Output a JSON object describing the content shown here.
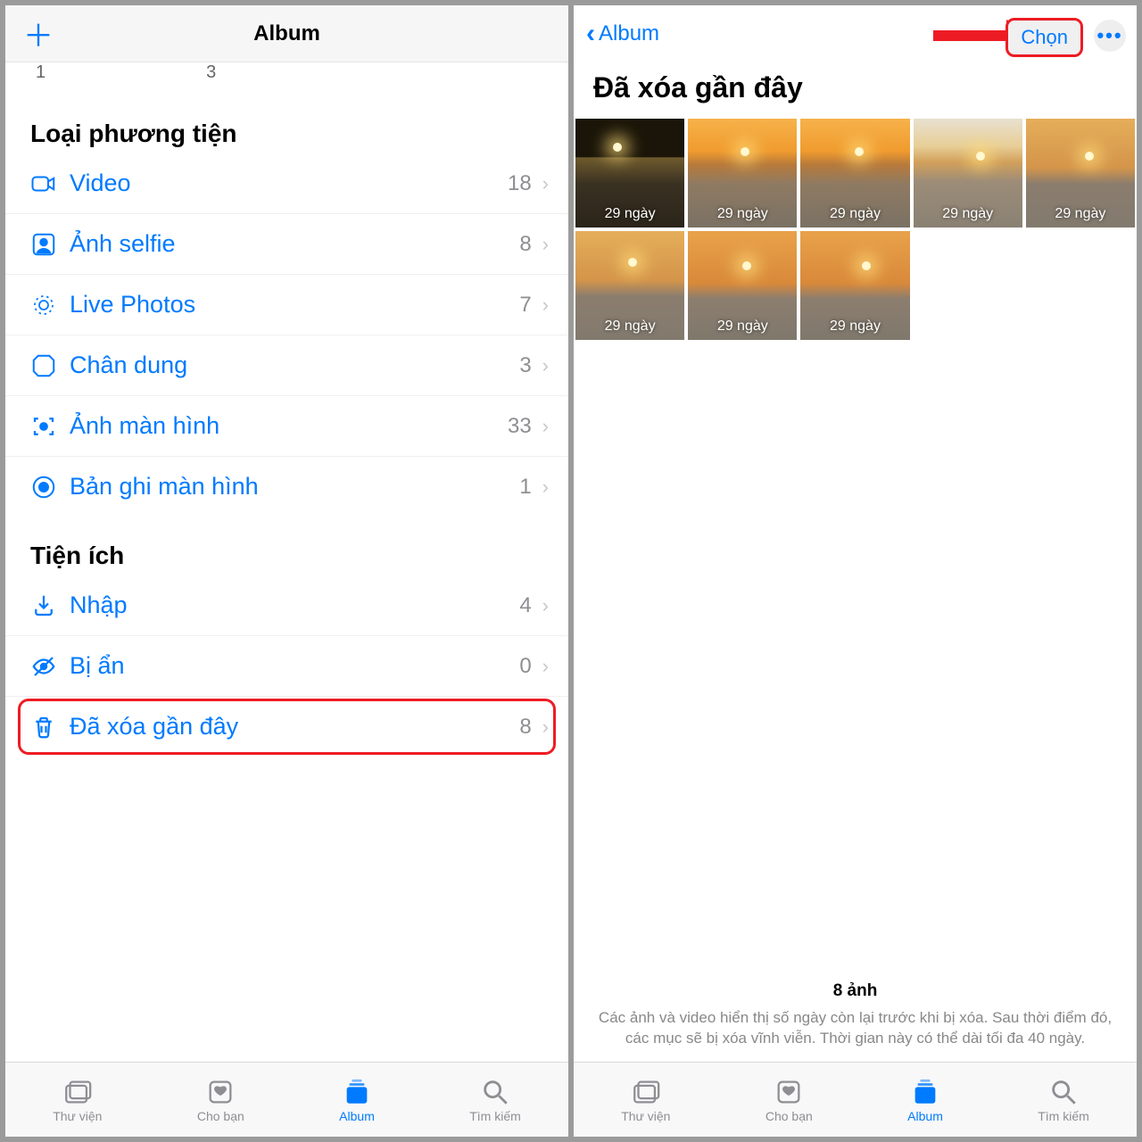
{
  "left": {
    "title": "Album",
    "nums": {
      "a": "1",
      "b": "3"
    },
    "section_media": "Loại phương tiện",
    "media_rows": [
      {
        "label": "Video",
        "count": "18"
      },
      {
        "label": "Ảnh selfie",
        "count": "8"
      },
      {
        "label": "Live Photos",
        "count": "7"
      },
      {
        "label": "Chân dung",
        "count": "3"
      },
      {
        "label": "Ảnh màn hình",
        "count": "33"
      },
      {
        "label": "Bản ghi màn hình",
        "count": "1"
      }
    ],
    "section_util": "Tiện ích",
    "util_rows": [
      {
        "label": "Nhập",
        "count": "4"
      },
      {
        "label": "Bị ẩn",
        "count": "0"
      },
      {
        "label": "Đã xóa gần đây",
        "count": "8"
      }
    ],
    "tabs": [
      {
        "label": "Thư viện"
      },
      {
        "label": "Cho bạn"
      },
      {
        "label": "Album"
      },
      {
        "label": "Tìm kiếm"
      }
    ]
  },
  "right": {
    "back": "Album",
    "select": "Chọn",
    "title": "Đã xóa gần đây",
    "day_label": "29 ngày",
    "footer_count": "8 ảnh",
    "footer_text": "Các ảnh và video hiển thị số ngày còn lại trước khi bị xóa. Sau thời điểm đó, các mục sẽ bị xóa vĩnh viễn. Thời gian này có thể dài tối đa 40 ngày.",
    "tabs": [
      {
        "label": "Thư viện"
      },
      {
        "label": "Cho bạn"
      },
      {
        "label": "Album"
      },
      {
        "label": "Tìm kiếm"
      }
    ]
  }
}
